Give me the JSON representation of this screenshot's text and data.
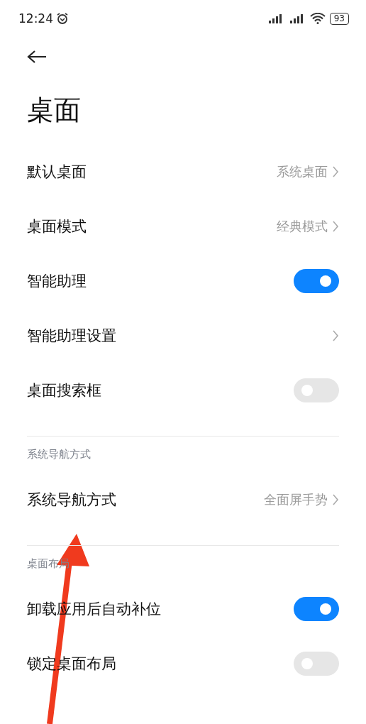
{
  "status_bar": {
    "time": "12:24",
    "battery": "93"
  },
  "title": "桌面",
  "sections": [
    {
      "items": [
        {
          "kind": "link",
          "label": "默认桌面",
          "value": "系统桌面"
        },
        {
          "kind": "link",
          "label": "桌面模式",
          "value": "经典模式"
        },
        {
          "kind": "toggle",
          "label": "智能助理",
          "on": true
        },
        {
          "kind": "link",
          "label": "智能助理设置"
        },
        {
          "kind": "toggle",
          "label": "桌面搜索框",
          "on": false
        }
      ]
    },
    {
      "header": "系统导航方式",
      "items": [
        {
          "kind": "link",
          "label": "系统导航方式",
          "value": "全面屏手势"
        }
      ]
    },
    {
      "header": "桌面布局",
      "items": [
        {
          "kind": "toggle",
          "label": "卸载应用后自动补位",
          "on": true
        },
        {
          "kind": "toggle",
          "label": "锁定桌面布局",
          "on": false
        }
      ]
    }
  ]
}
